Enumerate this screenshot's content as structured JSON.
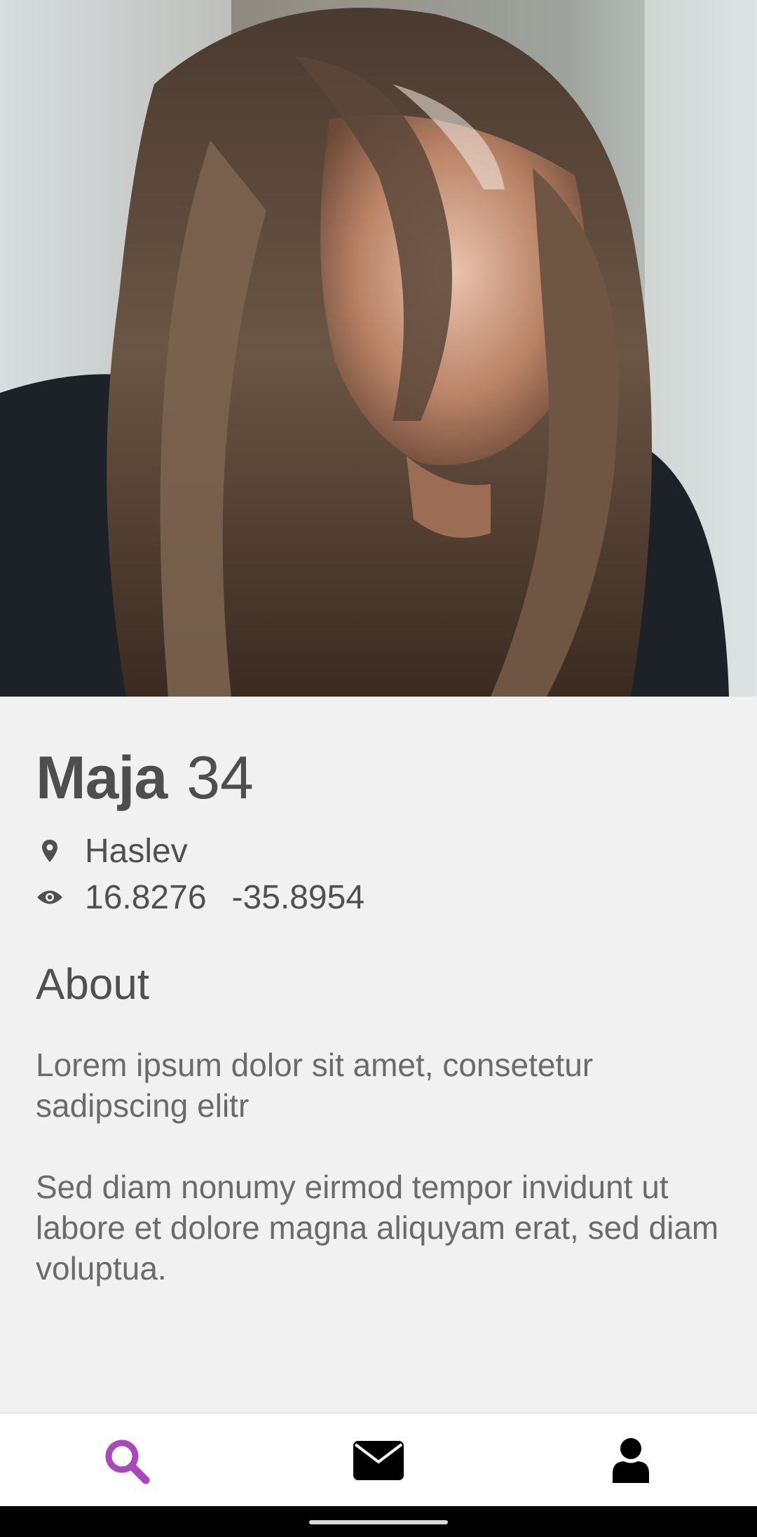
{
  "profile": {
    "name": "Maja",
    "age": "34",
    "location": "Haslev",
    "coord_x": "16.8276",
    "coord_y": "-35.8954",
    "location_icon": "map-pin-icon",
    "coords_icon": "eye-icon",
    "photo": "profile-photo"
  },
  "about": {
    "heading": "About",
    "paragraphs": [
      "Lorem ipsum dolor sit amet, consetetur sadipscing elitr",
      "Sed diam nonumy eirmod tempor invidunt ut labore et dolore magna aliquyam erat, sed diam voluptua."
    ]
  },
  "nav": {
    "items": [
      {
        "icon": "search-icon",
        "active": true
      },
      {
        "icon": "envelope-icon",
        "active": false
      },
      {
        "icon": "user-icon",
        "active": false
      }
    ],
    "active_color": "#ab47bc",
    "inactive_color": "#000000"
  }
}
